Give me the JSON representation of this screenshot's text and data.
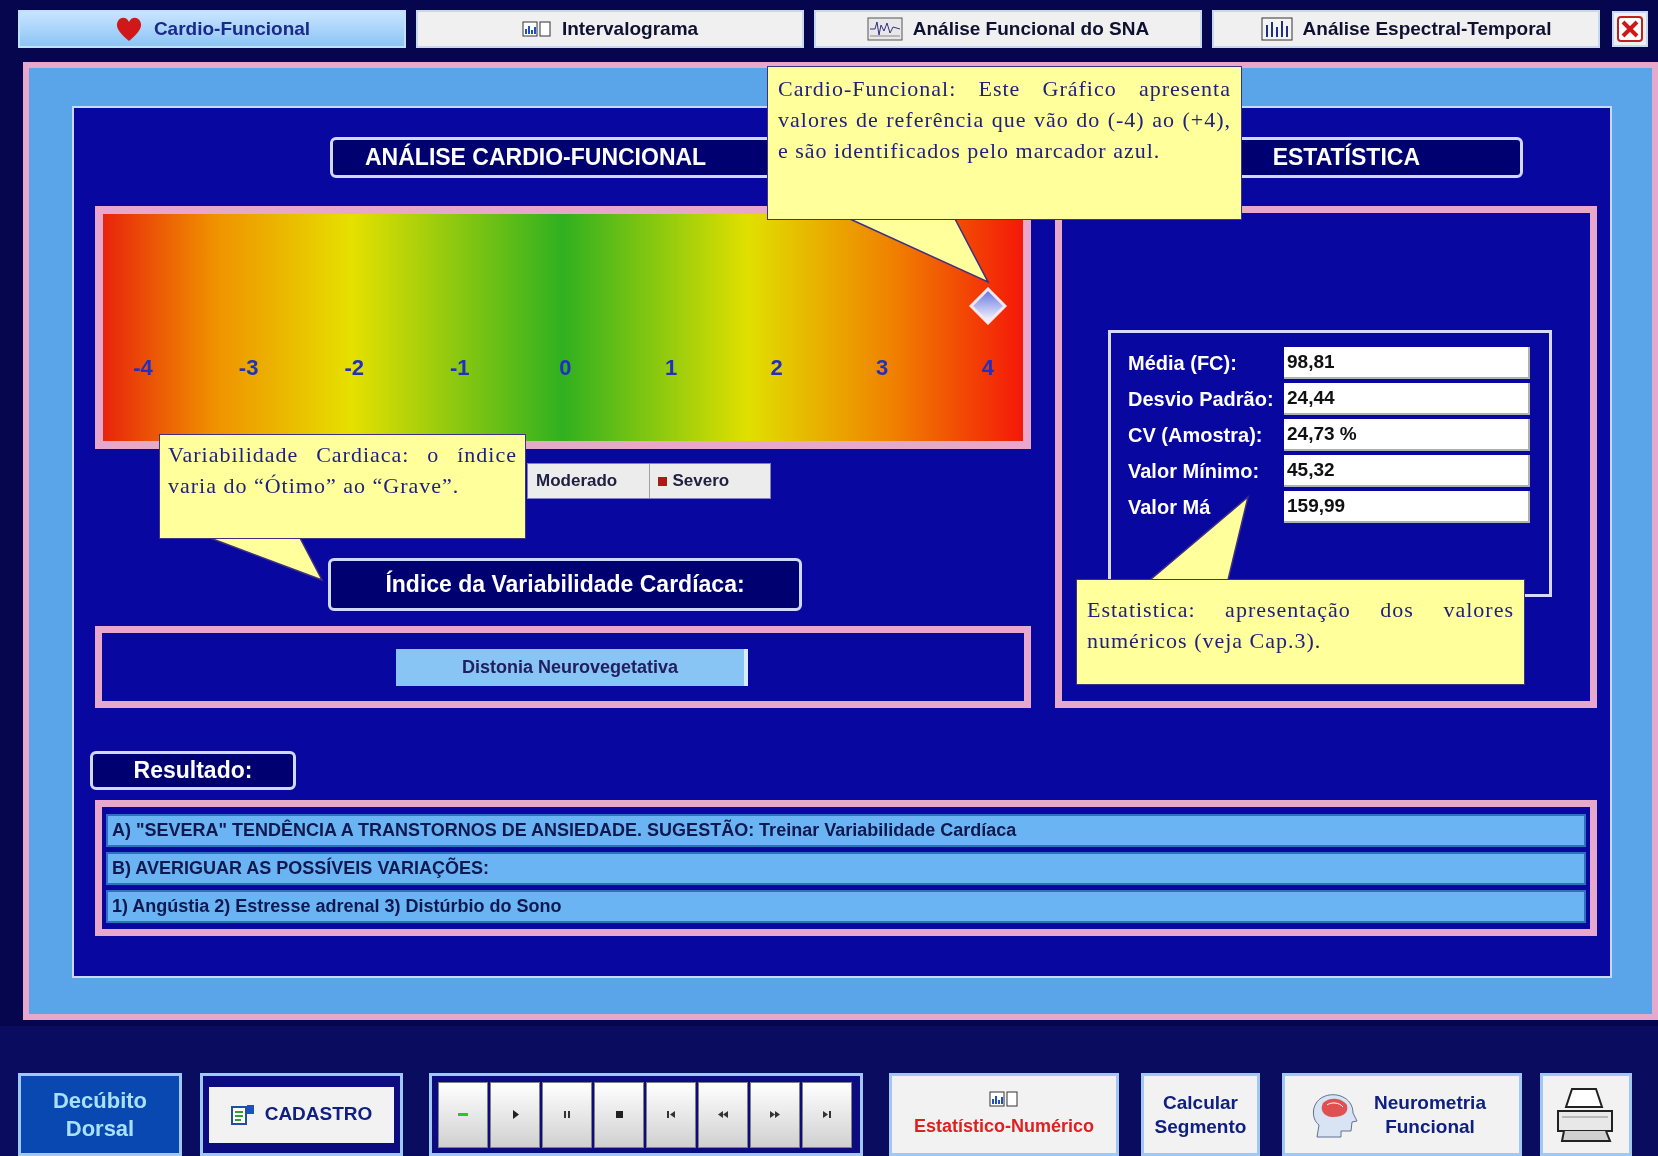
{
  "tabs": [
    {
      "label": "Cardio-Funcional",
      "selected": true,
      "kind": "heart"
    },
    {
      "label": "Intervalograma",
      "selected": false,
      "kind": "chart"
    },
    {
      "label": "Análise Funcional do SNA",
      "selected": false,
      "kind": "wave"
    },
    {
      "label": "Análise Espectral-Temporal",
      "selected": false,
      "kind": "bars"
    }
  ],
  "heading": {
    "left": "ANÁLISE CARDIO-FUNCIONAL",
    "right": "ESTATÍSTICA"
  },
  "scale": {
    "labels": [
      "-4",
      "-3",
      "-2",
      "-1",
      "0",
      "1",
      "2",
      "3",
      "4"
    ],
    "marker": {
      "level": 1
    }
  },
  "legend": [
    {
      "label": "Moderado"
    },
    {
      "label": "Severo",
      "color": "#b01818"
    }
  ],
  "index_label": "Índice da Variabilidade Cardíaca:",
  "index_value": "Distonia Neurovegetativa",
  "statistics": [
    {
      "label": "Média (FC):",
      "value": "98,81"
    },
    {
      "label": "Desvio Padrão:",
      "value": "24,44"
    },
    {
      "label": "CV (Amostra):",
      "value": "24,73 %"
    },
    {
      "label": "Valor Mínimo:",
      "value": "45,32"
    },
    {
      "label": "Valor Má",
      "value": "159,99"
    }
  ],
  "result_title": "Resultado:",
  "results": [
    "A) \"SEVERA\" TENDÊNCIA A TRANSTORNOS DE ANSIEDADE. SUGESTÃO: Treinar Variabilidade Cardíaca",
    "B) AVERIGUAR AS POSSÍVEIS VARIAÇÕES:",
    "1) Angústia 2) Estresse adrenal 3) Distúrbio do Sono"
  ],
  "callouts": [
    {
      "text": "Cardio-Funcional: Este Gráfico apresenta valores de referência que vão do (-4) ao (+4), e são identificados pelo marcador azul."
    },
    {
      "text": "Variabilidade Cardiaca: o índice varia do “Ótimo” ao “Grave”."
    },
    {
      "text": "Estatistica: apresentação dos valores numéricos (veja Cap.3)."
    }
  ],
  "toolbar": [
    {
      "kind": "status",
      "label": "Decúbito Dorsal"
    },
    {
      "kind": "cadastro",
      "label": "CADASTRO"
    },
    {
      "kind": "media"
    },
    {
      "kind": "stats",
      "label": "Estatístico-Numérico"
    },
    {
      "kind": "plain",
      "label": "Calcular Segmento"
    },
    {
      "kind": "brain",
      "label": "Neurometria Funcional"
    },
    {
      "kind": "printer"
    }
  ]
}
